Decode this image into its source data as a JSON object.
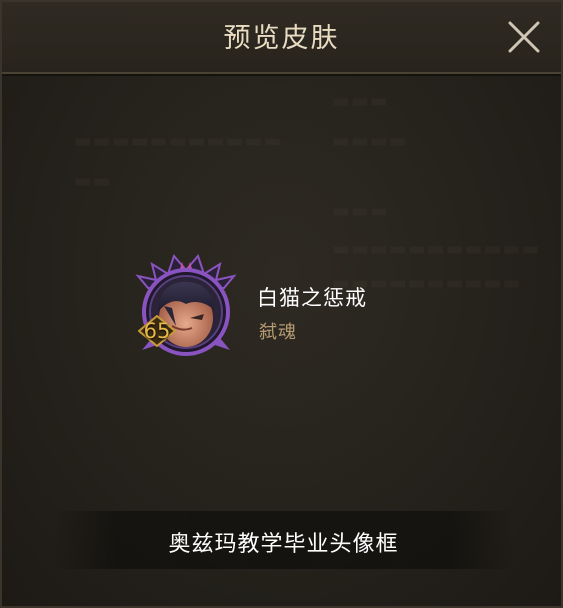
{
  "dialog": {
    "title": "预览皮肤",
    "close_icon": "close-icon"
  },
  "skin": {
    "level": "65",
    "name": "白猫之惩戒",
    "subtitle": "弑魂",
    "avatar_icon": "character-avatar-icon",
    "level_badge_icon": "diamond-level-badge-icon"
  },
  "footer": {
    "label": "奥兹玛教学毕业头像框"
  },
  "colors": {
    "title": "#e9dcc2",
    "subtitle": "#b59a72",
    "level": "#e8b94a",
    "frame_purple": "#8a54c0"
  }
}
